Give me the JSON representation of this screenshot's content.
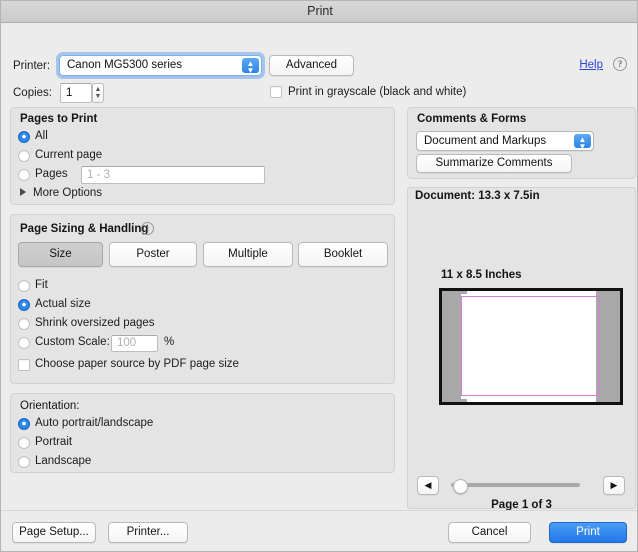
{
  "window": {
    "title": "Print"
  },
  "printer_row": {
    "printer_label": "Printer:",
    "printer_value": "Canon MG5300 series",
    "advanced_label": "Advanced",
    "help_label": "Help",
    "help_icon": "question-mark-circle-icon"
  },
  "copies_row": {
    "copies_label": "Copies:",
    "copies_value": "1",
    "grayscale_label": "Print in grayscale (black and white)",
    "grayscale_checked": false
  },
  "pages_to_print": {
    "title": "Pages to Print",
    "options": [
      {
        "label": "All",
        "selected": true
      },
      {
        "label": "Current page",
        "selected": false
      },
      {
        "label": "Pages",
        "selected": false
      }
    ],
    "pages_placeholder": "1 - 3",
    "more_options_label": "More Options"
  },
  "page_sizing": {
    "title": "Page Sizing & Handling",
    "info_icon": "info-circle-icon",
    "modes": [
      {
        "label": "Size",
        "selected": true
      },
      {
        "label": "Poster",
        "selected": false
      },
      {
        "label": "Multiple",
        "selected": false
      },
      {
        "label": "Booklet",
        "selected": false
      }
    ],
    "options": [
      {
        "label": "Fit",
        "selected": false
      },
      {
        "label": "Actual size",
        "selected": true
      },
      {
        "label": "Shrink oversized pages",
        "selected": false
      },
      {
        "label": "Custom Scale:",
        "selected": false
      }
    ],
    "custom_scale_value": "100",
    "percent_label": "%",
    "paper_source_label": "Choose paper source by PDF page size",
    "paper_source_checked": false
  },
  "orientation": {
    "title": "Orientation:",
    "options": [
      {
        "label": "Auto portrait/landscape",
        "selected": true
      },
      {
        "label": "Portrait",
        "selected": false
      },
      {
        "label": "Landscape",
        "selected": false
      }
    ]
  },
  "comments_forms": {
    "title": "Comments & Forms",
    "dropdown_value": "Document and Markups",
    "summarize_label": "Summarize Comments"
  },
  "preview": {
    "document_info": "Document: 13.3 x 7.5in",
    "sheet_size": "11 x 8.5 Inches",
    "prev_icon": "chevron-left-icon",
    "next_icon": "chevron-right-icon",
    "page_indicator": "Page 1 of 3",
    "slider_position_pct": 3
  },
  "footer": {
    "page_setup_label": "Page Setup...",
    "printer_label": "Printer...",
    "cancel_label": "Cancel",
    "print_label": "Print"
  },
  "colors": {
    "accent_blue": "#2b87ee",
    "link_blue": "#2a45d8",
    "primary_button": "#2278e8",
    "margin_outline": "#d77fd7",
    "window_bg": "#ececec",
    "group_bg": "#e4e4e4"
  }
}
